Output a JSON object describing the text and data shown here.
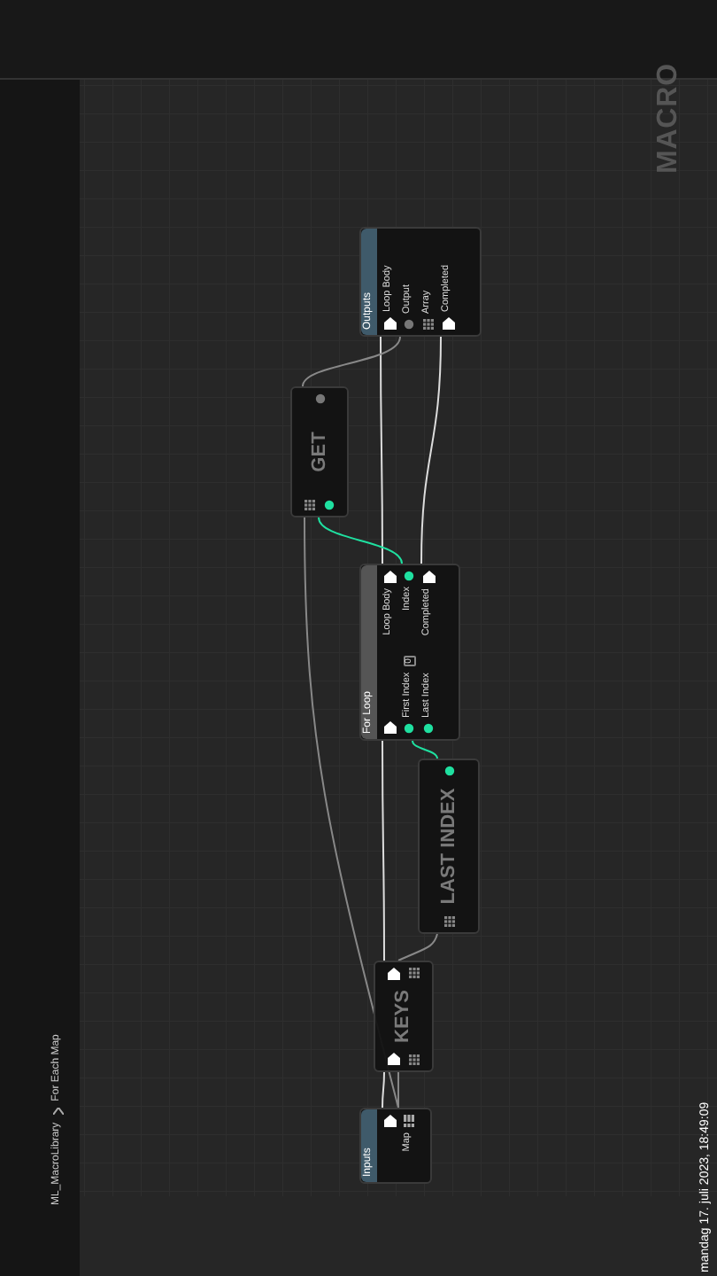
{
  "breadcrumb": [
    "ML_MacroLibrary",
    "For Each Map"
  ],
  "graph_label": "MACRO",
  "nodes": [
    {
      "kind": "tunnel",
      "title": "Inputs",
      "outputs": [
        {
          "kind": "exec"
        },
        {
          "kind": "map",
          "label": "Map"
        }
      ]
    },
    {
      "kind": "compact",
      "title": "KEYS",
      "inputs": [
        {
          "kind": "exec"
        },
        {
          "kind": "array"
        }
      ],
      "outputs": [
        {
          "kind": "exec"
        },
        {
          "kind": "array"
        }
      ]
    },
    {
      "kind": "compact",
      "title": "LAST INDEX",
      "inputs": [
        {
          "kind": "array"
        }
      ],
      "outputs": [
        {
          "kind": "int"
        }
      ]
    },
    {
      "kind": "function",
      "title": "For Loop",
      "inputs": [
        {
          "kind": "exec"
        },
        {
          "kind": "int",
          "label": "First Index",
          "value": "0"
        },
        {
          "kind": "int",
          "label": "Last Index"
        }
      ],
      "outputs": [
        {
          "kind": "exec",
          "label": "Loop Body"
        },
        {
          "kind": "int",
          "label": "Index"
        },
        {
          "kind": "exec",
          "label": "Completed"
        }
      ]
    },
    {
      "kind": "compact",
      "title": "GET",
      "inputs": [
        {
          "kind": "array"
        },
        {
          "kind": "int"
        }
      ],
      "outputs": [
        {
          "kind": "wildcard"
        }
      ]
    },
    {
      "kind": "tunnel",
      "title": "Outputs",
      "inputs": [
        {
          "kind": "exec",
          "label": "Loop Body"
        },
        {
          "kind": "wildcard",
          "label": "Output"
        },
        {
          "kind": "array",
          "label": "Array"
        },
        {
          "kind": "exec",
          "label": "Completed"
        }
      ]
    }
  ],
  "timestamp": "mandag 17. juli 2023, 18:49:09"
}
